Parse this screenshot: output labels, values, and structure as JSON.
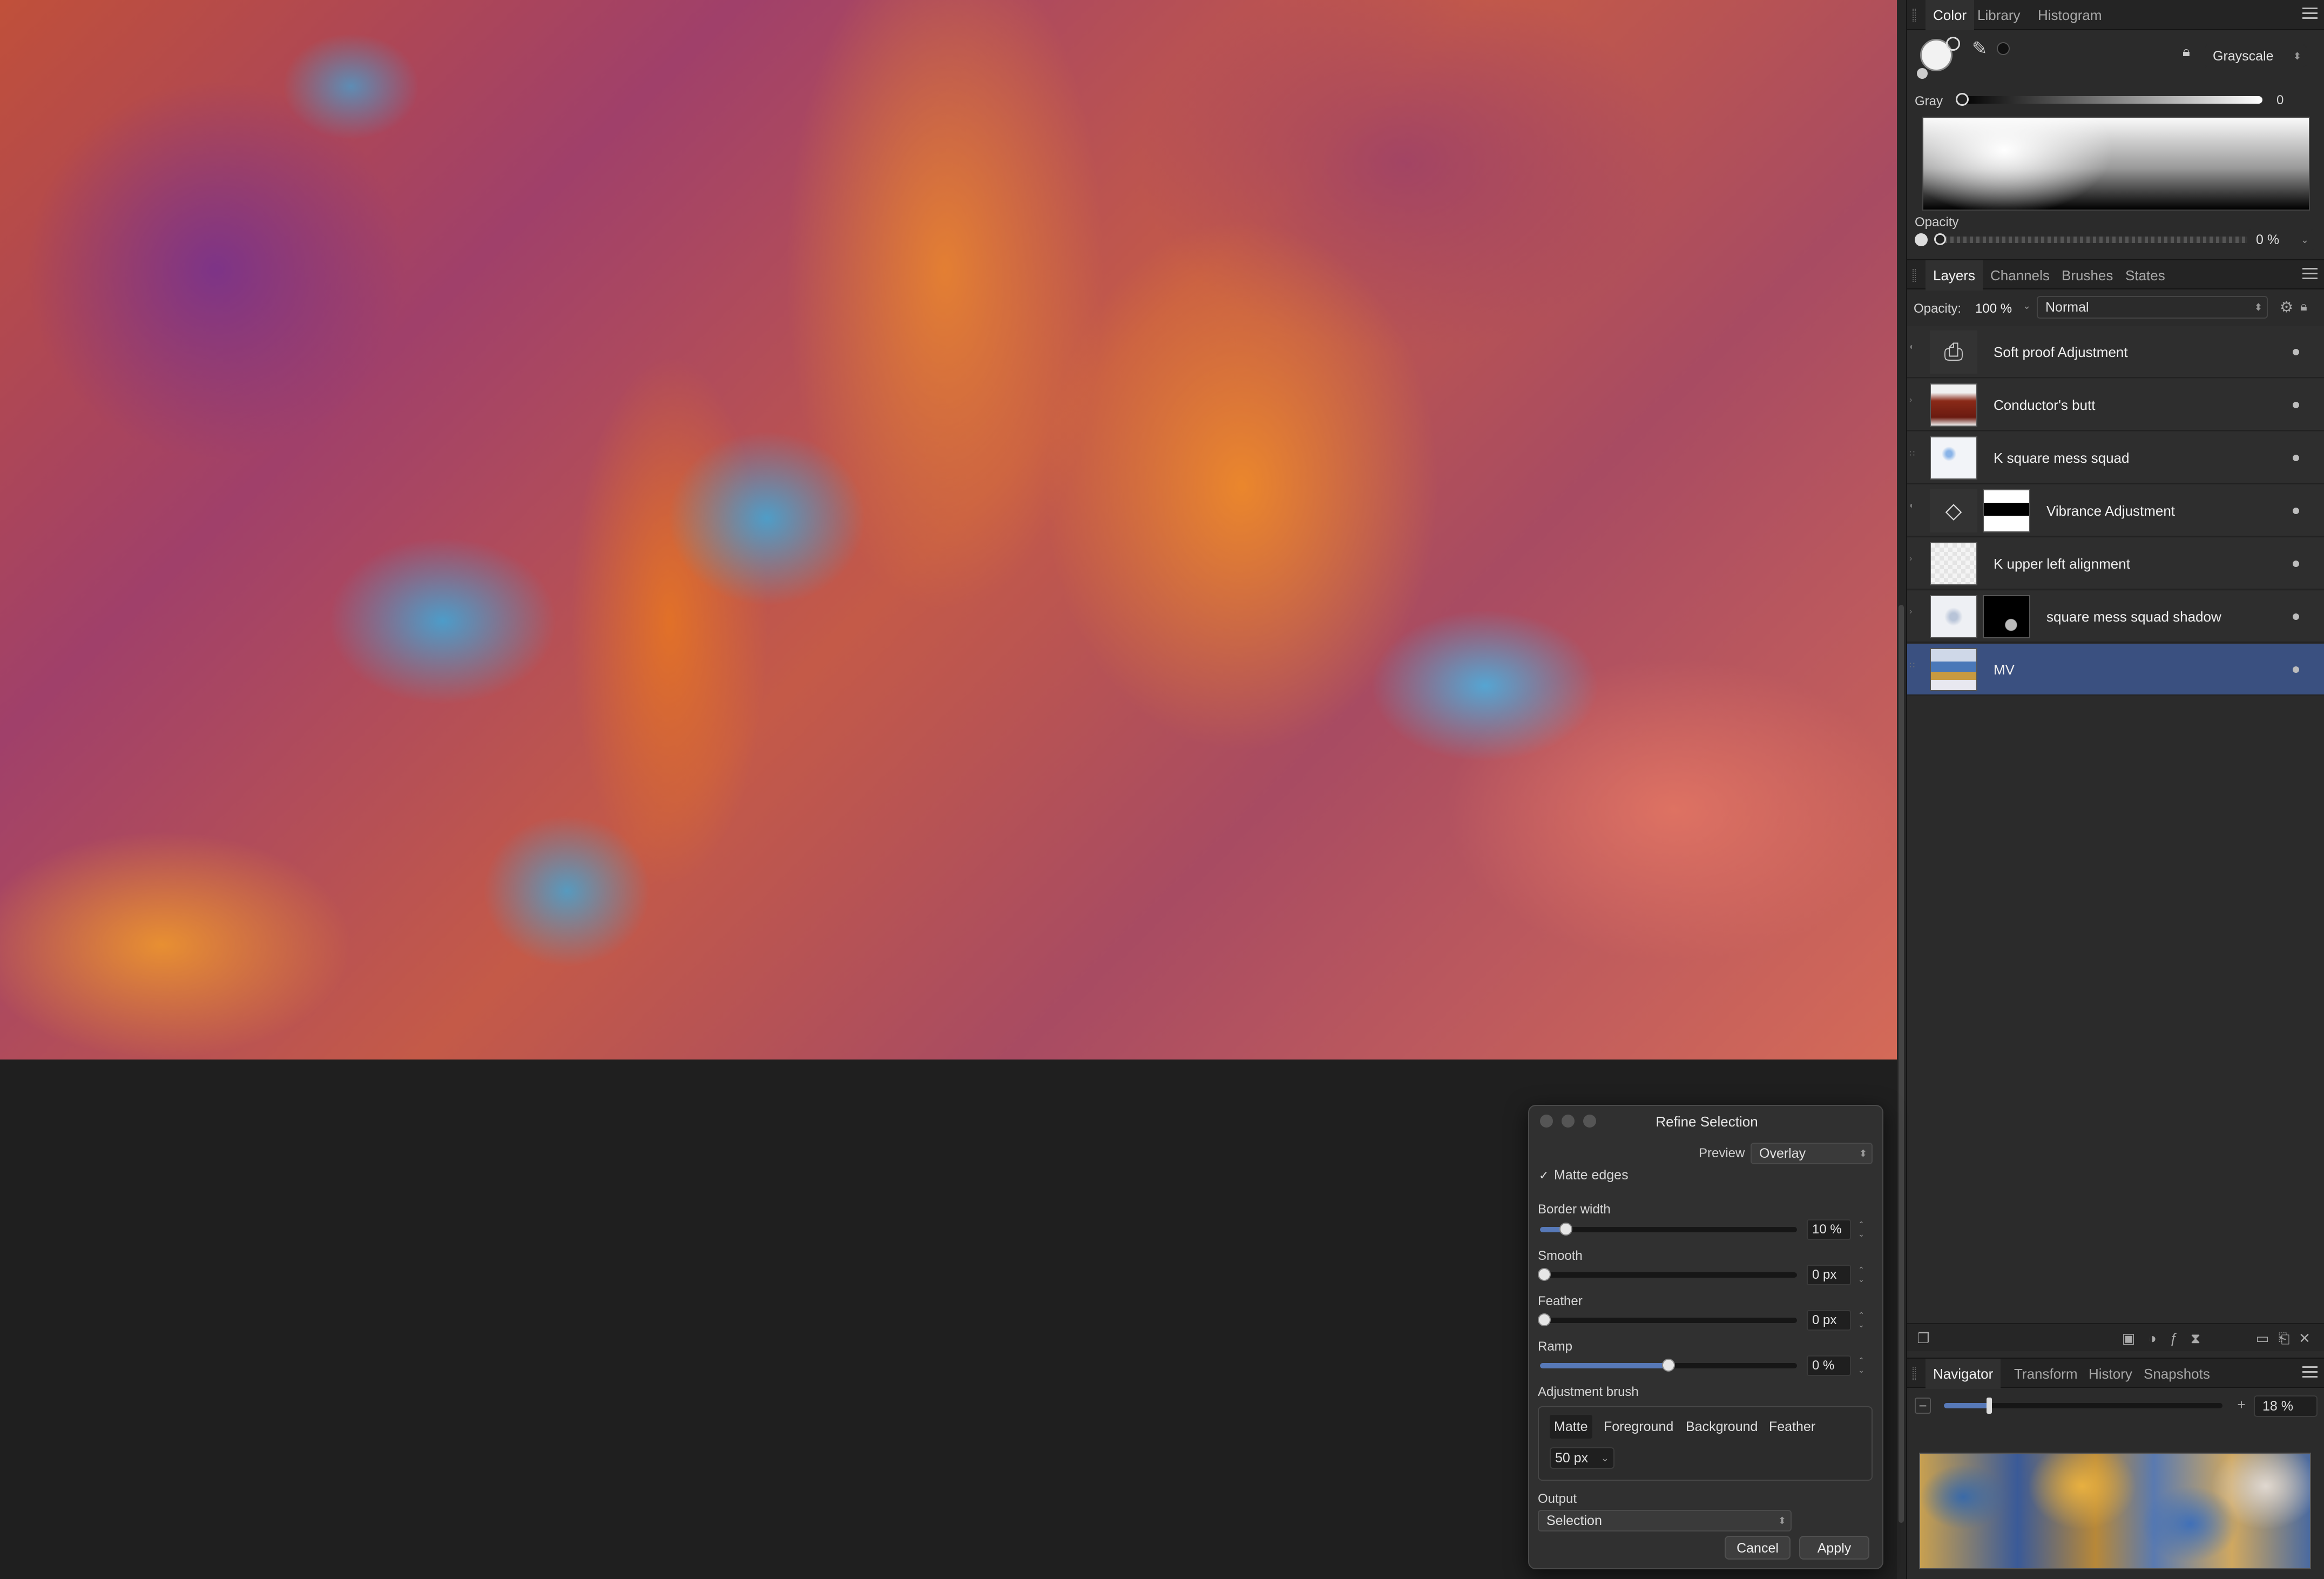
{
  "color_panel": {
    "tabs": [
      "Color",
      "Library",
      "Histogram"
    ],
    "mode": "Grayscale",
    "gray_label": "Gray",
    "gray_value": "0",
    "gray_level": 0,
    "opacity_label": "Opacity",
    "opacity_value": "0 %"
  },
  "layers_panel": {
    "tabs": [
      "Layers",
      "Channels",
      "Brushes",
      "States"
    ],
    "opacity_label": "Opacity:",
    "opacity_value": "100 %",
    "blend_mode": "Normal",
    "layers": [
      {
        "name": "Soft proof Adjustment",
        "thumb": "printer-icon",
        "selected": false
      },
      {
        "name": "Conductor's butt",
        "thumb": "image",
        "selected": false
      },
      {
        "name": "K square mess squad",
        "thumb": "image",
        "selected": false
      },
      {
        "name": "Vibrance Adjustment",
        "thumb": "diamond-icon",
        "selected": false
      },
      {
        "name": "K upper left alignment",
        "thumb": "image",
        "selected": false
      },
      {
        "name": "square mess squad shadow",
        "thumb": "image",
        "selected": false
      },
      {
        "name": "MV",
        "thumb": "image",
        "selected": true
      }
    ]
  },
  "navigator_panel": {
    "tabs": [
      "Navigator",
      "Transform",
      "History",
      "Snapshots"
    ],
    "zoom_value": "18 %",
    "zoom_level": 0.18
  },
  "refine_dialog": {
    "title": "Refine Selection",
    "preview_label": "Preview",
    "preview_value": "Overlay",
    "matte_edges_label": "Matte edges",
    "matte_edges_checked": true,
    "border_width_label": "Border width",
    "border_width_value": "10 %",
    "border_width_level": 0.1,
    "smooth_label": "Smooth",
    "smooth_value": "0 px",
    "feather_label": "Feather",
    "feather_value": "0 px",
    "ramp_label": "Ramp",
    "ramp_value": "0 %",
    "ramp_level": 0.5,
    "adjustment_brush_label": "Adjustment brush",
    "brush_modes": [
      "Matte",
      "Foreground",
      "Background",
      "Feather"
    ],
    "brush_size": "50 px",
    "output_label": "Output",
    "output_value": "Selection",
    "cancel_label": "Cancel",
    "apply_label": "Apply"
  }
}
